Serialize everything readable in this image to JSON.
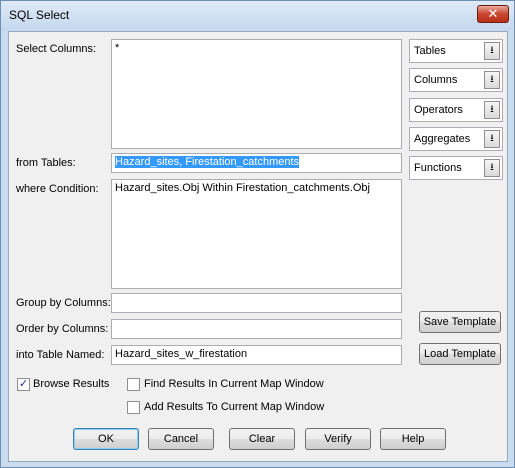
{
  "window": {
    "title": "SQL Select",
    "close_glyph": "✕"
  },
  "labels": {
    "select_columns": "Select Columns:",
    "from_tables": "from Tables:",
    "where_condition": "where Condition:",
    "group_by": "Group by Columns:",
    "order_by": "Order by Columns:",
    "into_table": "into Table Named:"
  },
  "fields": {
    "select_columns": "*",
    "from_tables": "Hazard_sites, Firestation_catchments",
    "where_condition": "Hazard_sites.Obj Within Firestation_catchments.Obj",
    "group_by": "",
    "order_by": "",
    "into_table": "Hazard_sites_w_firestation"
  },
  "dropdowns": [
    {
      "label": "Tables"
    },
    {
      "label": "Columns"
    },
    {
      "label": "Operators"
    },
    {
      "label": "Aggregates"
    },
    {
      "label": "Functions"
    }
  ],
  "template_buttons": {
    "save": "Save Template",
    "load": "Load Template"
  },
  "checkboxes": {
    "browse_results": {
      "label": "Browse Results",
      "checked": true
    },
    "find_results": {
      "label": "Find Results In Current Map Window",
      "checked": false
    },
    "add_results": {
      "label": "Add Results To Current Map Window",
      "checked": false
    }
  },
  "buttons": {
    "ok": "OK",
    "cancel": "Cancel",
    "clear": "Clear",
    "verify": "Verify",
    "help": "Help"
  },
  "icons": {
    "dropdown_arrow": "⭳",
    "checkmark": "✓"
  }
}
